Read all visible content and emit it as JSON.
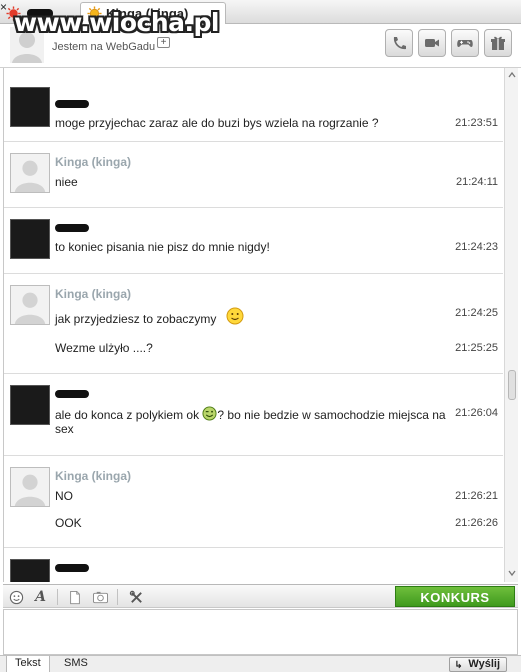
{
  "watermark": "www.wiocha.pl",
  "tabs": [
    {
      "label": ""
    },
    {
      "label": "Kinga (kinga)",
      "close": "×"
    }
  ],
  "header": {
    "status_text": "Jestem na WebGadu",
    "status_plus": "+",
    "buttons": [
      "phone-icon",
      "video-icon",
      "gamepad-icon",
      "gift-icon"
    ]
  },
  "messages": [
    {
      "sender": "",
      "avatar": "dark",
      "lines": [
        {
          "text": "moge przyjechac zaraz ale do buzi bys wziela na rogrzanie ?",
          "time": "21:23:51"
        }
      ]
    },
    {
      "sender": "Kinga (kinga)",
      "avatar": "light",
      "lines": [
        {
          "text": "niee",
          "time": "21:24:11"
        }
      ]
    },
    {
      "sender": "",
      "avatar": "dark",
      "lines": [
        {
          "text": "to koniec pisania nie pisz do mnie nigdy!",
          "time": "21:24:23"
        }
      ]
    },
    {
      "sender": "Kinga (kinga)",
      "avatar": "light",
      "lines": [
        {
          "text": "jak przyjedziesz to zobaczymy",
          "time": "21:24:25"
        },
        {
          "text": "Wezme ulżyło ....?",
          "time": "21:25:25"
        }
      ]
    },
    {
      "sender": "",
      "avatar": "dark",
      "lines": [
        {
          "text_before": "ale do konca z polykiem ok",
          "text_after": "? bo nie bedzie w samochodzie miejsca na",
          "text_wrap": "sex",
          "time": "21:26:04"
        }
      ]
    },
    {
      "sender": "Kinga (kinga)",
      "avatar": "light",
      "lines": [
        {
          "text": "NO",
          "time": "21:26:21"
        },
        {
          "text": "OOK",
          "time": "21:26:26"
        }
      ]
    },
    {
      "sender": "",
      "avatar": "dark",
      "lines": []
    }
  ],
  "toolbar": {
    "icons": [
      "emoticon-icon",
      "font-icon",
      "file-icon",
      "photo-icon",
      "tools-icon"
    ],
    "font_glyph": "A",
    "promo": "KONKURS"
  },
  "bottom": {
    "tab_text": "Tekst",
    "tab_sms": "SMS",
    "send": "Wyślij",
    "send_glyph": "↳"
  },
  "colors": {
    "sender_name": "#9aa6ad",
    "promo_green": "#3f9a1e"
  }
}
